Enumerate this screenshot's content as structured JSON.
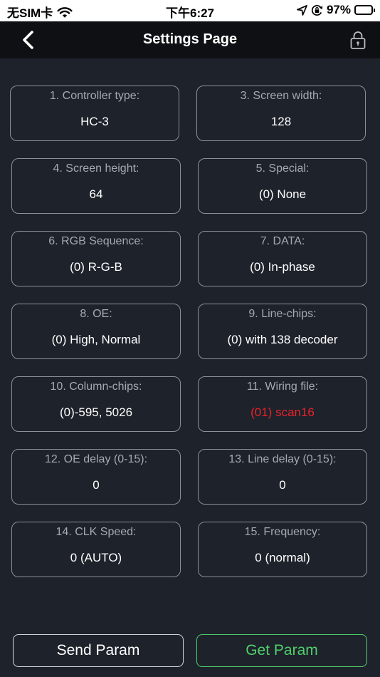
{
  "status_bar": {
    "carrier": "无SIM卡",
    "time": "下午6:27",
    "battery": "97%",
    "wifi_icon": "wifi-icon",
    "location_icon": "location-arrow-icon",
    "orientation_icon": "orientation-lock-icon",
    "battery_level": 0.97,
    "battery_color": "#34c759"
  },
  "nav": {
    "title": "Settings Page",
    "back_icon": "chevron-left-icon",
    "lock_icon": "lock-icon"
  },
  "colors": {
    "background": "#1e222b",
    "nav_background": "#0f1013",
    "card_border": "#8c9099",
    "label": "#a6a9b0",
    "value": "#ffffff",
    "alert_value": "#e8222a",
    "accent_green": "#4fd06b"
  },
  "settings": [
    {
      "label": "1. Controller type:",
      "value": "HC-3"
    },
    {
      "label": "3. Screen width:",
      "value": "128"
    },
    {
      "label": "4. Screen height:",
      "value": "64"
    },
    {
      "label": "5. Special:",
      "value": "(0) None"
    },
    {
      "label": "6. RGB Sequence:",
      "value": "(0) R-G-B"
    },
    {
      "label": "7. DATA:",
      "value": "(0) In-phase"
    },
    {
      "label": "8. OE:",
      "value": "(0) High, Normal"
    },
    {
      "label": "9. Line-chips:",
      "value": "(0) with 138 decoder"
    },
    {
      "label": "10. Column-chips:",
      "value": "(0)-595, 5026"
    },
    {
      "label": "11. Wiring file:",
      "value": "(01) scan16"
    },
    {
      "label": "12. OE delay (0-15):",
      "value": "0"
    },
    {
      "label": "13. Line delay (0-15):",
      "value": "0"
    },
    {
      "label": "14. CLK Speed:",
      "value": "0 (AUTO)"
    },
    {
      "label": "15. Frequency:",
      "value": "0 (normal)"
    }
  ],
  "buttons": {
    "send": "Send Param",
    "get": "Get Param"
  }
}
